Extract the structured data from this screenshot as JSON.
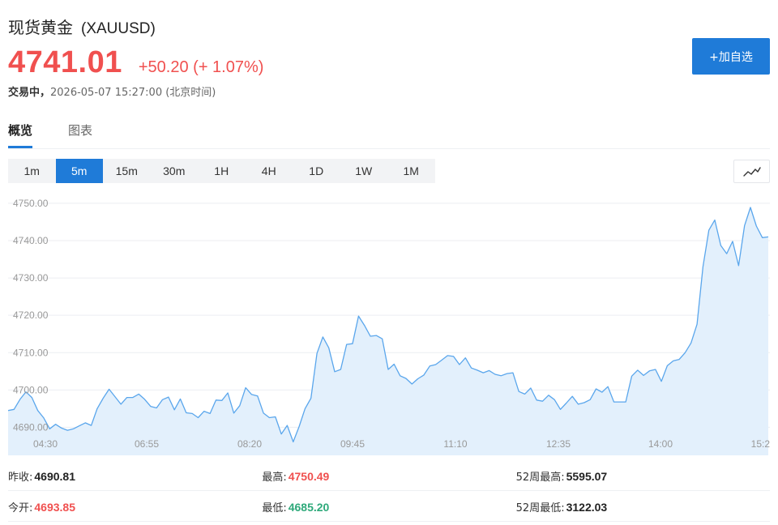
{
  "header": {
    "name": "现货黄金",
    "code": "(XAUUSD)",
    "price": "4741.01",
    "change": "+50.20 (+ 1.07%)",
    "status_label": "交易中，",
    "timestamp": "2026-05-07 15:27:00",
    "timezone": "(北京时间)",
    "add_button_label": "+加自选"
  },
  "tabs": [
    {
      "label": "概览",
      "active": true
    },
    {
      "label": "图表",
      "active": false
    }
  ],
  "periods": [
    "1m",
    "5m",
    "15m",
    "30m",
    "1H",
    "4H",
    "1D",
    "1W",
    "1M"
  ],
  "active_period": "5m",
  "chart_type_icon": "line-chart-icon",
  "colors": {
    "up": "#f0504f",
    "down": "#2ea97a",
    "accent": "#1f7bd8",
    "line": "#5aa6ec",
    "area": "#e3f0fc"
  },
  "chart_data": {
    "type": "area",
    "x_tick_labels": [
      "04:30",
      "06:55",
      "08:20",
      "09:45",
      "11:10",
      "12:35",
      "14:00",
      "15:2"
    ],
    "y_tick_labels": [
      "4690.00",
      "4700.00",
      "4710.00",
      "4720.00",
      "4730.00",
      "4740.00",
      "4750.00"
    ],
    "ylim": [
      4682.5,
      4752.8
    ],
    "grid": true,
    "values": [
      4694.5,
      4694.8,
      4697.5,
      4699.5,
      4698.0,
      4694.5,
      4692.5,
      4689.6,
      4690.8,
      4689.8,
      4689.2,
      4689.6,
      4690.4,
      4691.2,
      4690.5,
      4695.0,
      4697.8,
      4700.2,
      4698.2,
      4696.2,
      4698.0,
      4698.0,
      4698.9,
      4697.5,
      4695.6,
      4695.2,
      4697.4,
      4698.1,
      4694.7,
      4697.6,
      4693.9,
      4693.7,
      4692.6,
      4694.3,
      4693.7,
      4697.3,
      4697.2,
      4699.2,
      4693.8,
      4695.8,
      4700.6,
      4698.8,
      4698.4,
      4693.8,
      4692.6,
      4692.8,
      4688.2,
      4690.5,
      4686.1,
      4690.2,
      4695.0,
      4697.8,
      4709.8,
      4714.2,
      4711.3,
      4704.9,
      4705.5,
      4712.2,
      4712.4,
      4719.8,
      4717.3,
      4714.4,
      4714.6,
      4713.7,
      4705.5,
      4706.9,
      4703.8,
      4703.1,
      4701.6,
      4703.0,
      4704.0,
      4706.4,
      4706.8,
      4708.0,
      4709.2,
      4709.0,
      4706.8,
      4708.6,
      4705.9,
      4705.3,
      4704.6,
      4705.2,
      4704.2,
      4703.8,
      4704.4,
      4704.6,
      4699.6,
      4698.9,
      4700.5,
      4697.3,
      4697.0,
      4698.6,
      4697.4,
      4694.8,
      4696.5,
      4698.3,
      4696.2,
      4696.6,
      4697.4,
      4700.3,
      4699.4,
      4700.9,
      4696.8,
      4696.8,
      4696.8,
      4703.7,
      4705.3,
      4703.9,
      4705.1,
      4705.5,
      4702.3,
      4706.5,
      4707.8,
      4708.2,
      4710.0,
      4712.6,
      4717.6,
      4733.0,
      4742.8,
      4745.5,
      4738.7,
      4736.5,
      4739.8,
      4733.3,
      4744.0,
      4748.9,
      4743.9,
      4740.8,
      4741.0
    ]
  },
  "stats": [
    [
      {
        "label": "昨收:",
        "value": "4690.81",
        "tone": "neutral"
      },
      {
        "label": "最高:",
        "value": "4750.49",
        "tone": "up"
      },
      {
        "label": "52周最高:",
        "value": "5595.07",
        "tone": "neutral"
      }
    ],
    [
      {
        "label": "今开:",
        "value": "4693.85",
        "tone": "up"
      },
      {
        "label": "最低:",
        "value": "4685.20",
        "tone": "down"
      },
      {
        "label": "52周最低:",
        "value": "3122.03",
        "tone": "neutral"
      }
    ]
  ]
}
